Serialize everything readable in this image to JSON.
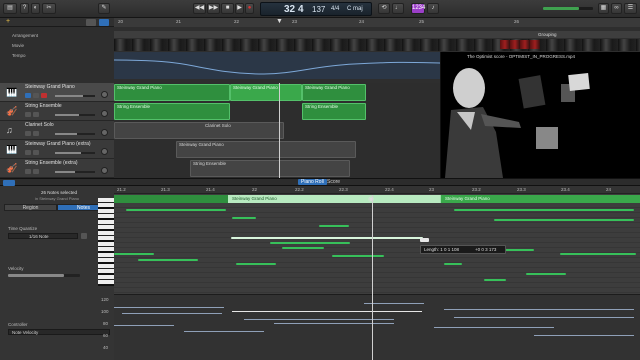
{
  "transport": {
    "lcd": {
      "bar": "32",
      "beat": "4",
      "bpm": "137",
      "key": "C maj",
      "sig": "4/4"
    },
    "chip": "1234"
  },
  "ruler": {
    "marks": [
      "20",
      "21",
      "22",
      "23",
      "24",
      "25",
      "26"
    ]
  },
  "globals": {
    "arrangement": "Arrangement",
    "movie": "Movie",
    "tempo": "Tempo",
    "grouping": "Grouping"
  },
  "tracks": [
    {
      "name": "Steinway Grand Piano",
      "selected": true
    },
    {
      "name": "String Ensemble",
      "selected": false
    },
    {
      "name": "Clarinet Solo",
      "selected": false
    },
    {
      "name": "Steinway Grand Piano (extra)",
      "selected": false
    },
    {
      "name": "String Ensemble (extra)",
      "selected": false
    }
  ],
  "regions": {
    "piano1": "Steinway Grand Piano",
    "piano2": "Steinway Grand Piano",
    "piano3": "Steinway Grand Piano",
    "strings1": "String Ensemble",
    "strings2": "String Ensemble",
    "clarinet": "Clarinet Solo",
    "piano4": "Steinway Grand Piano",
    "strings3": "String Ensemble"
  },
  "video": {
    "title": "The Optimist score - OPTIMIST_IN_PROGRESS.mp4"
  },
  "editor": {
    "tab_piano": "Piano Roll",
    "tab_score": "Score"
  },
  "inspector": {
    "selection": "26 Notes selected",
    "selection_sub": "in Steinway Grand Piano",
    "tab_region": "Region",
    "tab_notes": "Notes",
    "quantize_label": "Time Quantize",
    "quantize_value": "1/16 Note",
    "velocity_label": "Velocity",
    "controller_label": "Controller",
    "controller_value": "Note Velocity"
  },
  "roll": {
    "marks": [
      "21.2",
      "21.3",
      "21.4",
      "22",
      "22.2",
      "22.3",
      "22.4",
      "23",
      "23.2",
      "23.3",
      "23.4",
      "24"
    ],
    "region_a": "Steinway Grand Piano",
    "region_b": "Steinway Grand Piano",
    "tooltip_length": "Length: 1 0 1 108",
    "tooltip_pos": "+0 0 3 173",
    "vel_scale": [
      "120",
      "100",
      "80",
      "60",
      "40"
    ]
  }
}
